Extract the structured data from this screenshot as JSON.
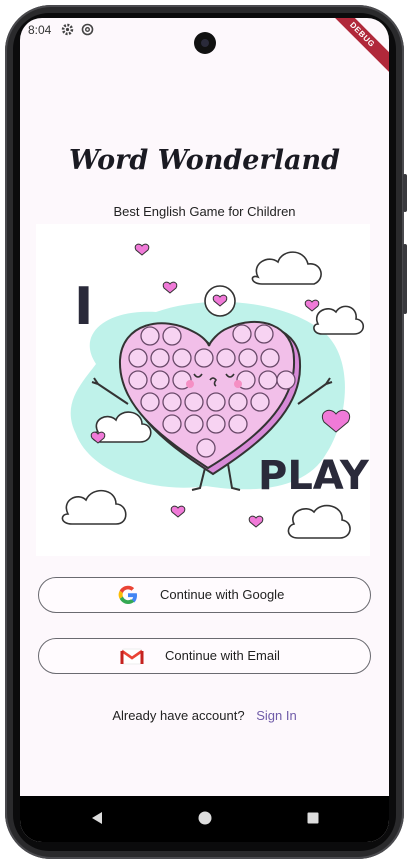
{
  "status_bar": {
    "time": "8:04",
    "icons": [
      "gear-icon",
      "at-icon"
    ]
  },
  "debug_banner": {
    "label": "DEBUG"
  },
  "app": {
    "title": "Word Wonderland",
    "subtitle": "Best English Game for Children"
  },
  "hero": {
    "text_left": "I",
    "text_right": "PLAY",
    "face": "ᵕεᵕ"
  },
  "actions": {
    "google_label": "Continue with Google",
    "email_label": "Continue with Email"
  },
  "account": {
    "question": "Already have account?",
    "signin_label": "Sign In"
  },
  "colors": {
    "accent": "#6f5ba8",
    "heart": "#f2bfe9",
    "blob": "#bff2ea",
    "text": "#1a1a22"
  },
  "nav": {
    "icons": [
      "back-icon",
      "home-icon",
      "recents-icon"
    ]
  }
}
